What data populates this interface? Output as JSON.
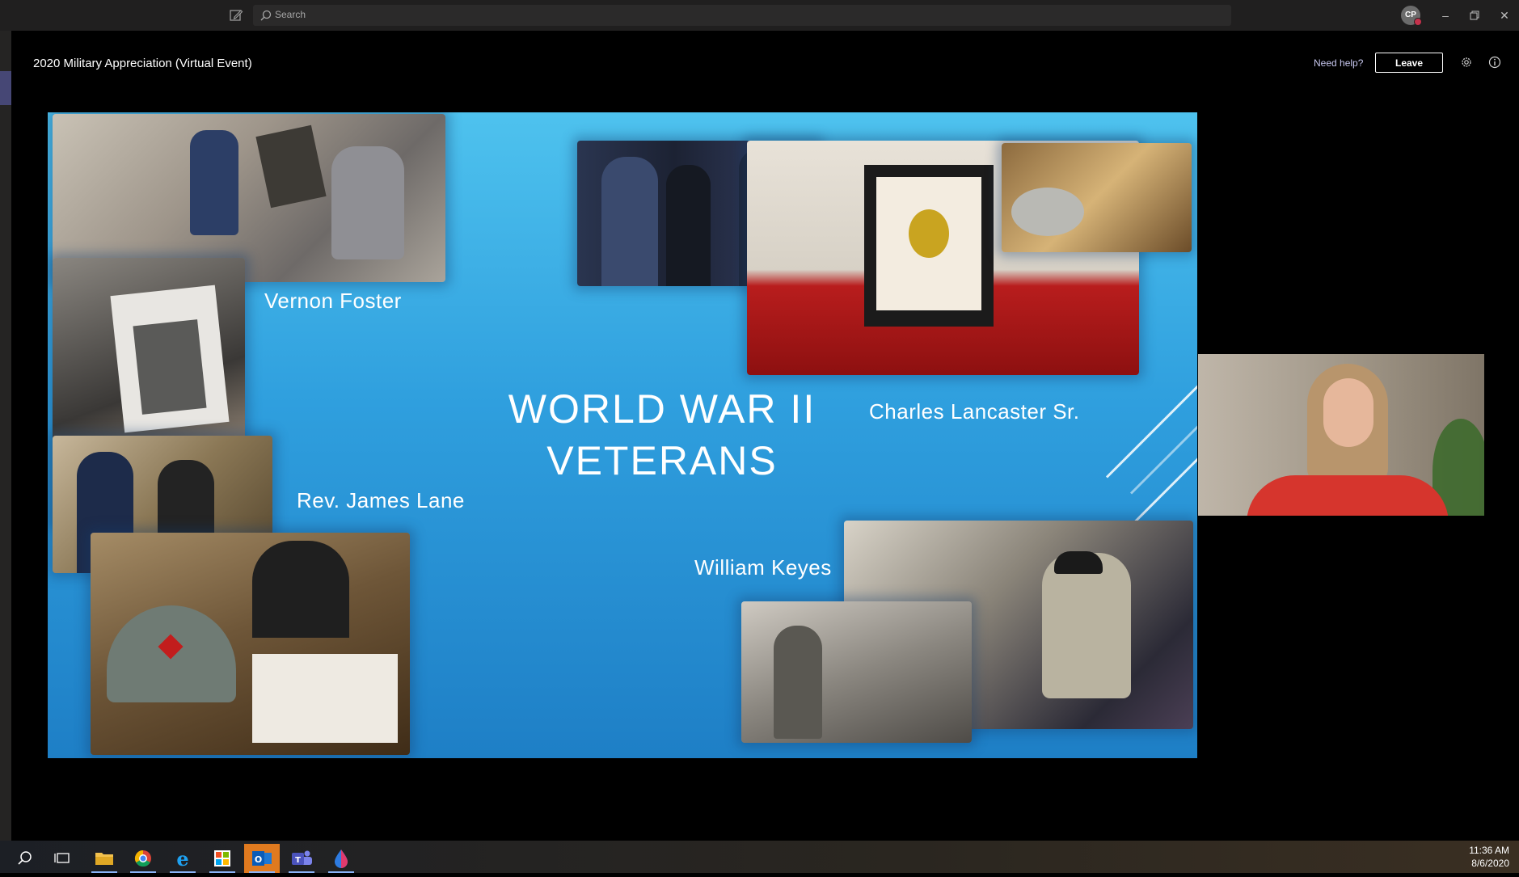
{
  "titlebar": {
    "search_placeholder": "Search",
    "avatar_initials": "CP"
  },
  "meeting": {
    "title": "2020 Military Appreciation (Virtual Event)",
    "need_help": "Need help?",
    "leave_label": "Leave"
  },
  "slide": {
    "title_line1": "WORLD WAR II",
    "title_line2": "VETERANS",
    "names": {
      "vernon": "Vernon Foster",
      "charles": "Charles Lancaster Sr.",
      "james": "Rev. James Lane",
      "william": "William Keyes"
    }
  },
  "taskbar": {
    "apps": [
      "search-icon",
      "task-view-icon",
      "file-explorer-icon",
      "chrome-icon",
      "internet-explorer-icon",
      "store-icon",
      "outlook-icon",
      "teams-icon",
      "paint-icon"
    ],
    "time": "11:36 AM",
    "date": "8/6/2020"
  },
  "colors": {
    "slide_top": "#4ec2ee",
    "slide_bottom": "#1e7fc6",
    "teams_accent": "#464775",
    "leave_border": "#ffffff"
  }
}
